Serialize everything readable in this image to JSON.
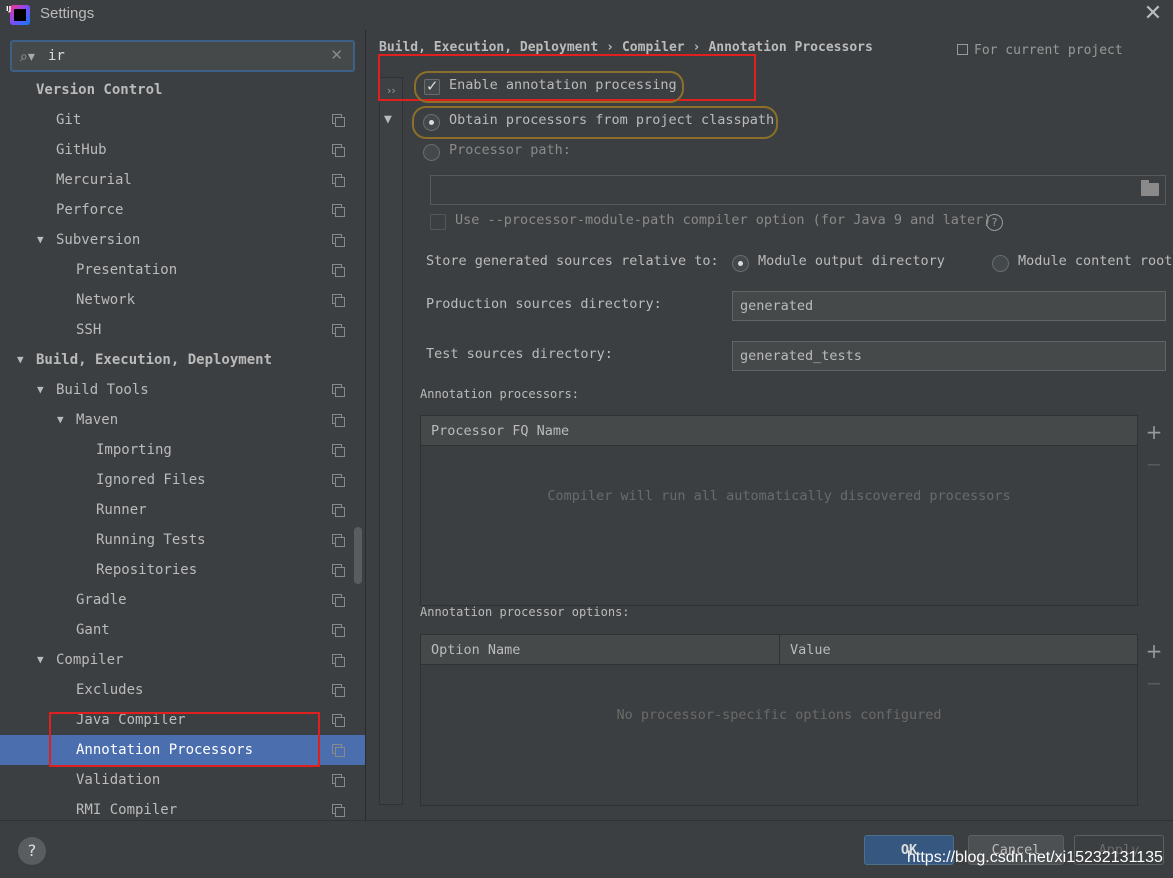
{
  "window": {
    "title": "Settings",
    "app_icon_text": "IJ",
    "close_glyph": "✕"
  },
  "search": {
    "value": "ir",
    "icon_glyph": "⌕▾",
    "clear_glyph": "✕"
  },
  "tree": [
    {
      "label": "Version Control",
      "bold": true,
      "indent": 36,
      "arrow": false,
      "copy": false
    },
    {
      "label": "Git",
      "bold": false,
      "indent": 56,
      "arrow": false,
      "copy": true
    },
    {
      "label": "GitHub",
      "bold": false,
      "indent": 56,
      "arrow": false,
      "copy": true
    },
    {
      "label": "Mercurial",
      "bold": false,
      "indent": 56,
      "arrow": false,
      "copy": true
    },
    {
      "label": "Perforce",
      "bold": false,
      "indent": 56,
      "arrow": false,
      "copy": true
    },
    {
      "label": "Subversion",
      "bold": false,
      "indent": 56,
      "arrow": true,
      "copy": true
    },
    {
      "label": "Presentation",
      "bold": false,
      "indent": 76,
      "arrow": false,
      "copy": true
    },
    {
      "label": "Network",
      "bold": false,
      "indent": 76,
      "arrow": false,
      "copy": true
    },
    {
      "label": "SSH",
      "bold": false,
      "indent": 76,
      "arrow": false,
      "copy": true
    },
    {
      "label": "Build, Execution, Deployment",
      "bold": true,
      "indent": 36,
      "arrow": true,
      "copy": false
    },
    {
      "label": "Build Tools",
      "bold": false,
      "indent": 56,
      "arrow": true,
      "copy": true
    },
    {
      "label": "Maven",
      "bold": false,
      "indent": 76,
      "arrow": true,
      "copy": true
    },
    {
      "label": "Importing",
      "bold": false,
      "indent": 96,
      "arrow": false,
      "copy": true
    },
    {
      "label": "Ignored Files",
      "bold": false,
      "indent": 96,
      "arrow": false,
      "copy": true
    },
    {
      "label": "Runner",
      "bold": false,
      "indent": 96,
      "arrow": false,
      "copy": true
    },
    {
      "label": "Running Tests",
      "bold": false,
      "indent": 96,
      "arrow": false,
      "copy": true
    },
    {
      "label": "Repositories",
      "bold": false,
      "indent": 96,
      "arrow": false,
      "copy": true
    },
    {
      "label": "Gradle",
      "bold": false,
      "indent": 76,
      "arrow": false,
      "copy": true
    },
    {
      "label": "Gant",
      "bold": false,
      "indent": 76,
      "arrow": false,
      "copy": true
    },
    {
      "label": "Compiler",
      "bold": false,
      "indent": 56,
      "arrow": true,
      "copy": true
    },
    {
      "label": "Excludes",
      "bold": false,
      "indent": 76,
      "arrow": false,
      "copy": true
    },
    {
      "label": "Java Compiler",
      "bold": false,
      "indent": 76,
      "arrow": false,
      "copy": true
    },
    {
      "label": "Annotation Processors",
      "bold": false,
      "indent": 76,
      "arrow": false,
      "copy": true,
      "selected": true
    },
    {
      "label": "Validation",
      "bold": false,
      "indent": 76,
      "arrow": false,
      "copy": true
    },
    {
      "label": "RMI Compiler",
      "bold": false,
      "indent": 76,
      "arrow": false,
      "copy": true
    }
  ],
  "tree_arrow_glyph": "▼",
  "breadcrumb": {
    "part1": "Build, Execution, Deployment",
    "part2": "Compiler",
    "part3": "Annotation Processors",
    "separator": "›"
  },
  "scope_label": "For current project",
  "profile": {
    "expand_glyph": "››",
    "collapse_glyph": "▼"
  },
  "options": {
    "enable_processing_label": "Enable annotation processing",
    "enable_processing_checked": true,
    "obtain_classpath_label": "Obtain processors from project classpath",
    "processor_path_label": "Processor path:",
    "processor_path_value": "",
    "module_path_option_label": "Use --processor-module-path compiler option (for Java 9 and later)",
    "help_glyph": "?",
    "store_relative_label": "Store generated sources relative to:",
    "module_output_label": "Module output directory",
    "module_content_label": "Module content root",
    "production_dir_label": "Production sources directory:",
    "production_dir_value": "generated",
    "test_dir_label": "Test sources directory:",
    "test_dir_value": "generated_tests"
  },
  "processors_table": {
    "section_label": "Annotation processors:",
    "column": "Processor FQ Name",
    "empty_text": "Compiler will run all automatically discovered processors",
    "add_glyph": "+",
    "remove_glyph": "−"
  },
  "options_table": {
    "section_label": "Annotation processor options:",
    "col_name": "Option Name",
    "col_value": "Value",
    "empty_text": "No processor-specific options configured",
    "add_glyph": "+",
    "remove_glyph": "−"
  },
  "footer": {
    "help_glyph": "?",
    "ok_label": "OK",
    "cancel_label": "Cancel",
    "apply_label": "Apply",
    "watermark": "https://blog.csdn.net/xi15232131135"
  },
  "colors": {
    "background": "#3c3f41",
    "selection": "#4b6eaf",
    "annotation_red": "#e01f1f",
    "annotation_gold": "#8c6f2a"
  }
}
